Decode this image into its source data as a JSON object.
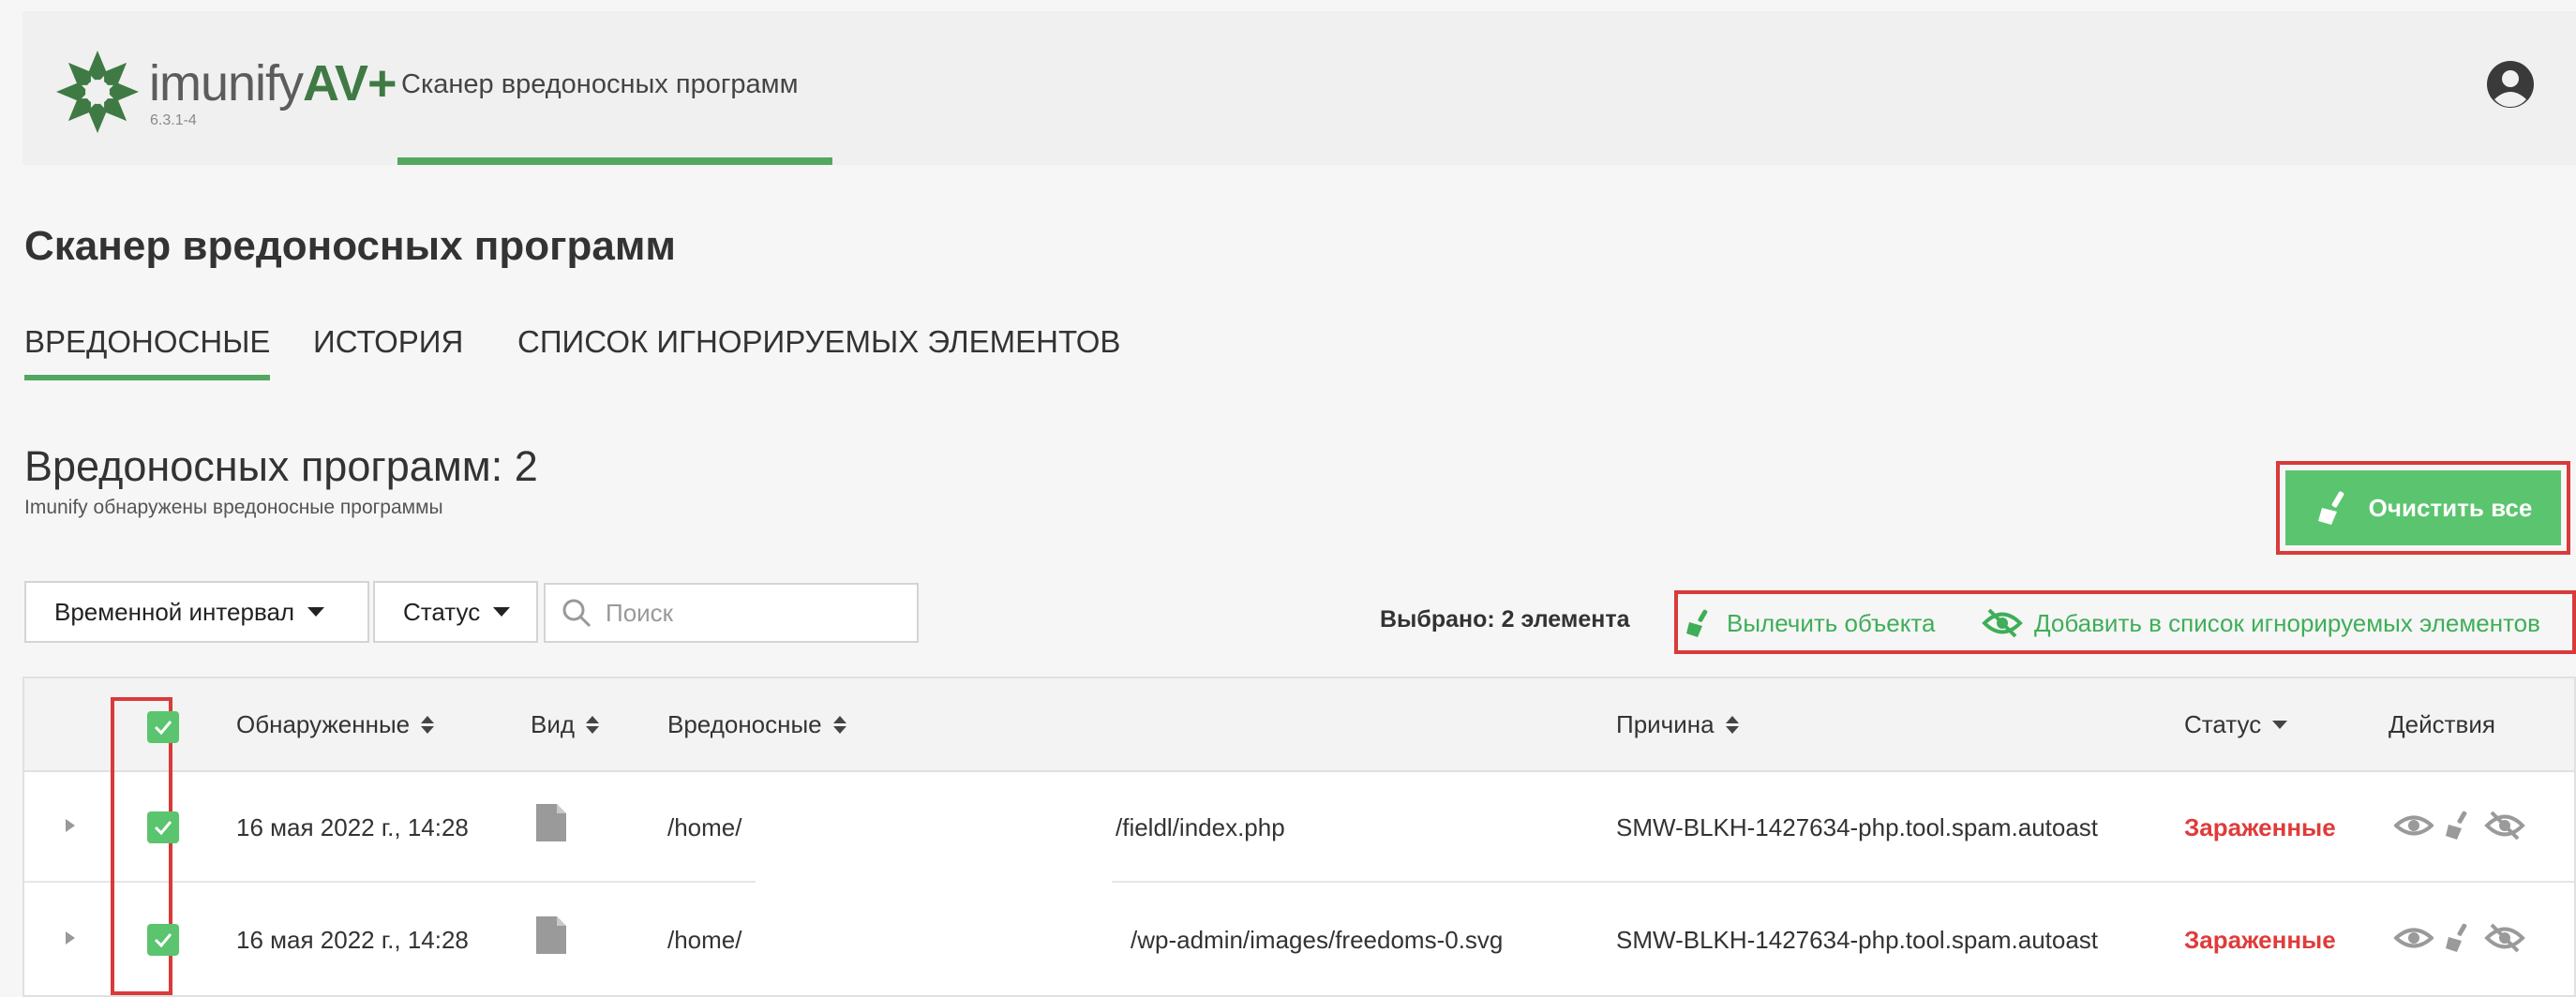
{
  "header": {
    "brand_prefix": "imunify",
    "brand_suffix": "AV+",
    "version": "6.3.1-4",
    "active_tab": "Сканер вредоносных программ"
  },
  "page_title": "Сканер вредоносных программ",
  "tabs": [
    "ВРЕДОНОСНЫЕ",
    "ИСТОРИЯ",
    "СПИСОК ИГНОРИРУЕМЫХ ЭЛЕМЕНТОВ"
  ],
  "summary": {
    "title": "Вредоносных программ: 2",
    "subtitle": "Imunify обнаружены вредоносные программы"
  },
  "clean_all_label": "Очистить все",
  "filters": {
    "time_interval": "Временной интервал",
    "status": "Статус",
    "search_placeholder": "Поиск"
  },
  "bulk": {
    "selected": "Выбрано: 2 элемента",
    "cure": "Вылечить объекта",
    "ignore": "Добавить в список игнорируемых элементов"
  },
  "columns": {
    "detected": "Обнаруженные",
    "type": "Вид",
    "malicious": "Вредоносные",
    "reason": "Причина",
    "status": "Статус",
    "actions": "Действия"
  },
  "rows": [
    {
      "date": "16 мая 2022 г., 14:28",
      "path_start": "/home/",
      "path_end": "/fieldl/index.php",
      "reason": "SMW-BLKH-1427634-php.tool.spam.autoast",
      "status": "Зараженные"
    },
    {
      "date": "16 мая 2022 г., 14:28",
      "path_start": "/home/",
      "path_end": "/wp-admin/images/freedoms-0.svg",
      "reason": "SMW-BLKH-1427634-php.tool.spam.autoast",
      "status": "Зараженные"
    }
  ],
  "colors": {
    "accent": "#54a760",
    "button": "#5bc46e",
    "infected": "#e03b3b",
    "highlight": "#d93a3a"
  }
}
